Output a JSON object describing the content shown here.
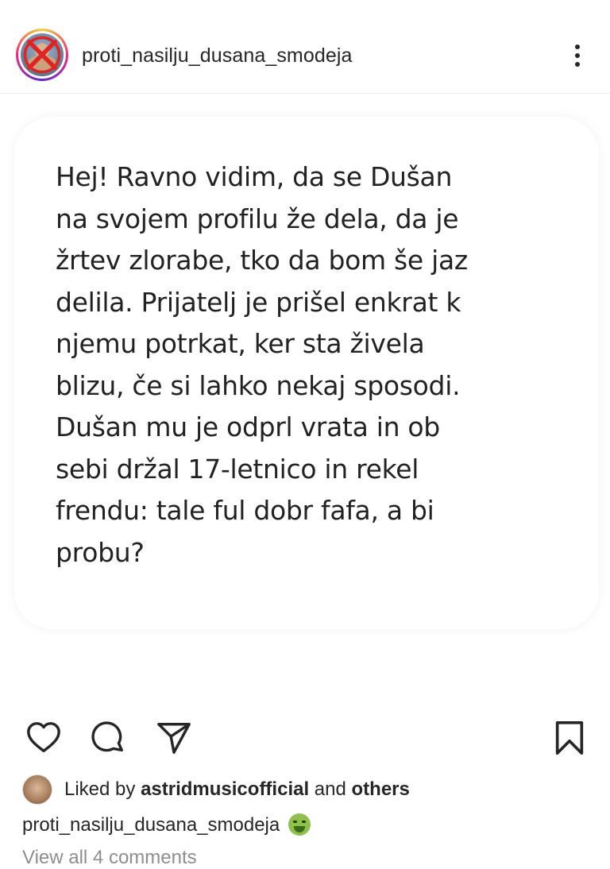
{
  "header": {
    "username": "proti_nasilju_dusana_smodeja"
  },
  "post": {
    "lines": [
      "Hej! Ravno vidim, da se Dušan",
      "na svojem profilu že dela, da je",
      "žrtev zlorabe, tko da bom še jaz",
      "delila. Prijatelj je prišel enkrat k",
      "njemu potrkat, ker sta živela",
      "blizu, če si lahko nekaj sposodi.",
      "Dušan mu je odprl vrata in ob",
      "sebi držal 17-letnico in rekel",
      "frendu: tale ful dobr fafa, a bi",
      "probu?"
    ]
  },
  "actions": {
    "icons": [
      "heart-icon",
      "comment-icon",
      "share-icon",
      "bookmark-icon"
    ]
  },
  "likes": {
    "prefix": "Liked by",
    "user": "astridmusicofficial",
    "middle": "and",
    "others": "others"
  },
  "caption": {
    "username": "proti_nasilju_dusana_smodeja",
    "emoji": "nauseated-face-emoji"
  },
  "comments": {
    "view_all": "View all 4 comments"
  },
  "colors": {
    "text": "#262626",
    "muted": "#8e8e8e",
    "story_ring": "#ee2a7b",
    "no_sign": "#e02424"
  }
}
